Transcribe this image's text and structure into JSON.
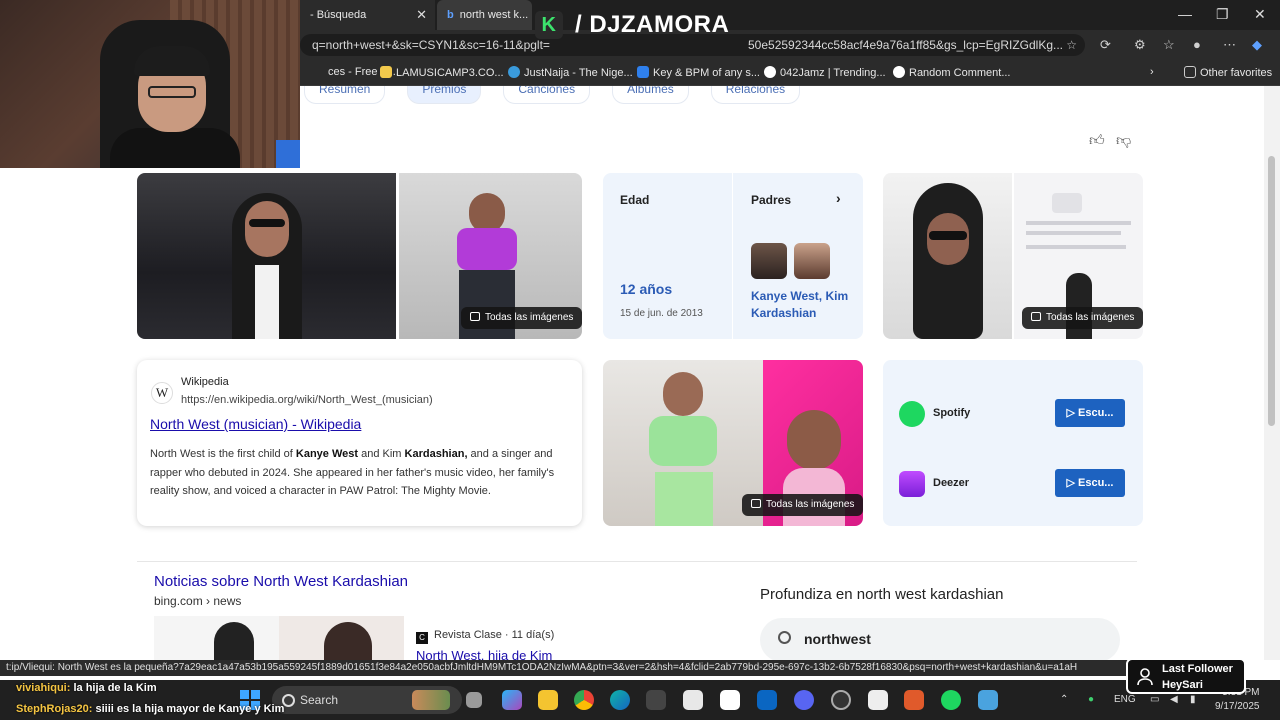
{
  "browser": {
    "tabs": [
      {
        "label": "- Búsqueda"
      },
      {
        "label": "north west k..."
      }
    ],
    "overlay_brand": "/ DJZAMORA",
    "url_left": "q=north+west+&sk=CSYN1&sc=16-11&pglt=",
    "url_right": "50e52592344cc58acf4e9a76a1ff85&gs_lcp=EgRIZGdlKg...",
    "bookmarks": [
      {
        "label": "ces - Free M...",
        "color": "#d8452e"
      },
      {
        "label": "LAMUSICAMP3.CO...",
        "color": "#f2c94c"
      },
      {
        "label": "JustNaija - The Nige...",
        "color": "#3a9bdc"
      },
      {
        "label": "Key & BPM of any s...",
        "color": "#2f80ed"
      },
      {
        "label": "042Jamz | Trending...",
        "color": "#ffffff"
      },
      {
        "label": "Random Comment...",
        "color": "#ffffff"
      }
    ],
    "other_favorites": "Other favorites"
  },
  "page": {
    "subtabs": [
      "Resumen",
      "Premios",
      "Canciones",
      "Álbumes",
      "Relaciones"
    ],
    "images_label": "Todas las imágenes",
    "facts": {
      "age_label": "Edad",
      "age_value": "12 años",
      "birth_date": "15 de jun. de 2013",
      "parents_label": "Padres",
      "parents_value": "Kanye West, Kim Kardashian"
    },
    "wiki": {
      "source": "Wikipedia",
      "url": "https://en.wikipedia.org/wiki/North_West_(musician)",
      "title": "North West (musician) - Wikipedia",
      "snippet_1": "North West is the first child of ",
      "snippet_b1": "Kanye West",
      "snippet_2": " and Kim ",
      "snippet_b2": "Kardashian,",
      "snippet_3": " and a singer and rapper who debuted in 2024. She appeared in her father's music video, her family's reality show, and voiced a character in PAW Patrol: The Mighty Movie."
    },
    "music": [
      {
        "service": "Spotify",
        "button": "▷ Escu...",
        "color": "#1ed760"
      },
      {
        "service": "Deezer",
        "button": "▷ Escu...",
        "color": "#a238ff"
      }
    ],
    "news": {
      "heading": "Noticias sobre North West Kardashian",
      "source_line": "bing.com › news",
      "item_source": "Revista Clase · 11 día(s)",
      "item_title": "North West, hija de Kim"
    },
    "deep_dive": {
      "heading": "Profundiza en north west kardashian",
      "query": "northwest"
    }
  },
  "status_url": "t:ip/Vliequi:  North West es la pequeña?7a29eac1a47a53b195a559245f1889d01651f3e84a2e050acbfJmltdHM9MTc1ODA2NzIwMA&ptn=3&ver=2&hsh=4&fclid=2ab779bd-295e-697c-13b2-6b7528f16830&psq=north+west+kardashian&u=a1aH",
  "chat": [
    {
      "user": "viviahiqui:",
      "text": " la hija de la Kim"
    },
    {
      "user": "StephRojas20:",
      "text": " siiii es la hija mayor de Kanye y Kim"
    }
  ],
  "taskbar": {
    "search": "Search",
    "lang": "ENG",
    "time": "5:31 PM",
    "date": "9/17/2025"
  },
  "last_follower": {
    "label": "Last Follower",
    "name": "HeySari"
  }
}
